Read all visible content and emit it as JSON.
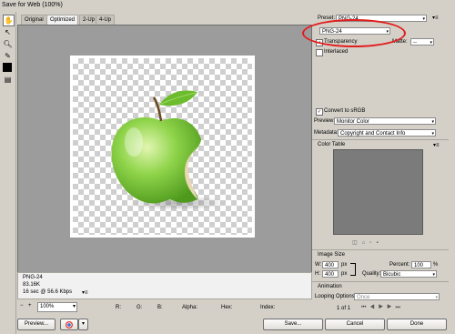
{
  "window": {
    "title": "Save for Web (100%)"
  },
  "tabs": [
    "Original",
    "Optimized",
    "2-Up",
    "4-Up"
  ],
  "image_info": {
    "format": "PNG-24",
    "size": "83.16K",
    "time": "16 sec @ 56.6 Kbps",
    "menu_glyph": "▾≡"
  },
  "bottom": {
    "zoom": "100%",
    "readouts": {
      "r": "R:",
      "g": "G:",
      "b": "B:",
      "alpha": "Alpha:",
      "hex": "Hex:",
      "index": "Index:"
    },
    "nav_glyph": "◂ ▸"
  },
  "buttons": {
    "preview": "Preview...",
    "save": "Save...",
    "cancel": "Cancel",
    "done": "Done"
  },
  "panel": {
    "preset_label": "Preset:",
    "preset_value": "PNG-24",
    "format_value": "PNG-24",
    "transparency_label": "Transparency",
    "matte_label": "Matte:",
    "matte_value": "--",
    "interlaced_label": "Interlaced",
    "convert_label": "Convert to sRGB",
    "preview_label": "Preview:",
    "preview_value": "Monitor Color",
    "metadata_label": "Metadata:",
    "metadata_value": "Copyright and Contact Info",
    "color_table_label": "Color Table",
    "image_size_label": "Image Size",
    "w_label": "W:",
    "w_value": "400",
    "h_label": "H:",
    "h_value": "400",
    "px": "px",
    "percent_label": "Percent:",
    "percent_value": "100",
    "percent_unit": "%",
    "quality_label": "Quality:",
    "quality_value": "Bicubic",
    "animation_label": "Animation",
    "looping_label": "Looping Options:",
    "looping_value": "Once",
    "frame_counter": "1 of 1",
    "panel_menu_glyph": "▾≡",
    "arrow_glyph": "▾"
  },
  "colors": {
    "highlight_oval": "#e21d1d",
    "canvas_bg": "#9c9c9c",
    "apple": "#7cc23b"
  }
}
